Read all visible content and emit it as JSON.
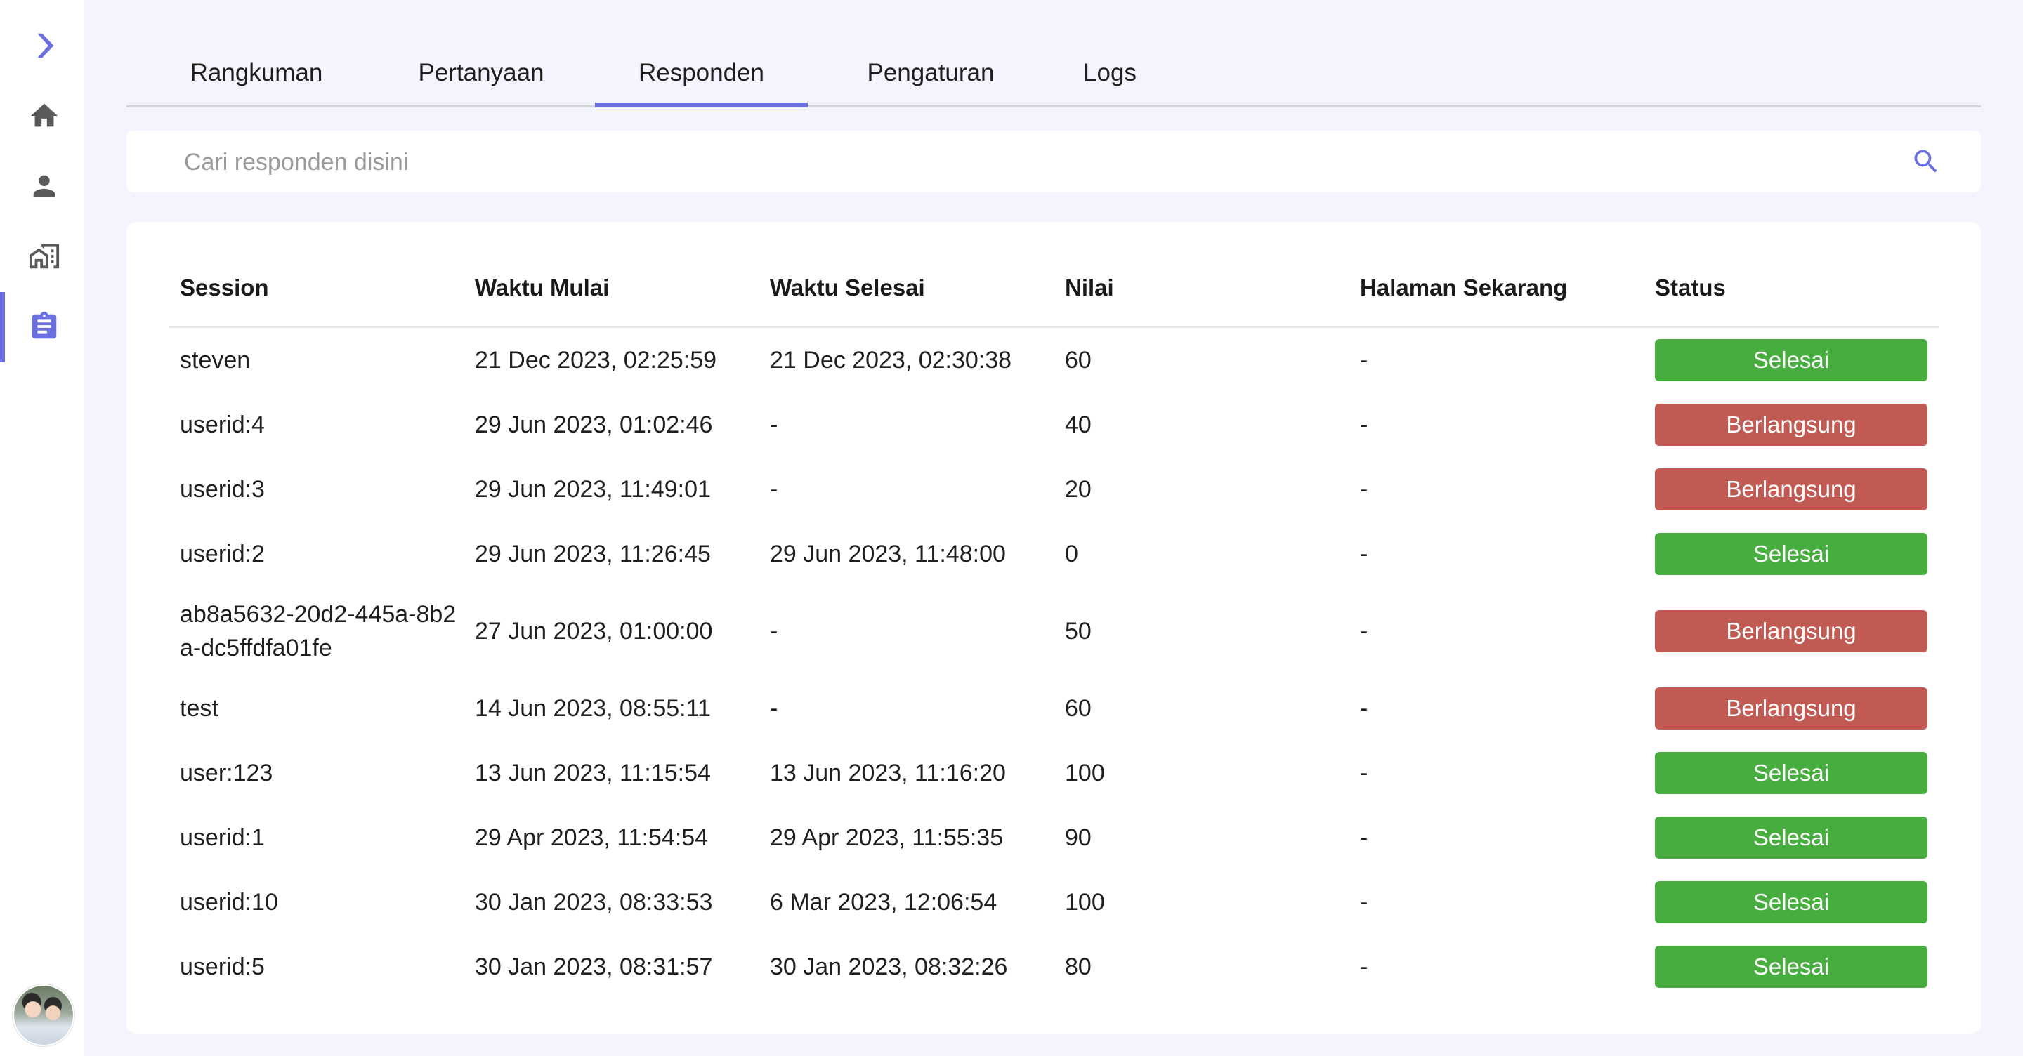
{
  "tabs": [
    {
      "label": "Rangkuman",
      "active": false
    },
    {
      "label": "Pertanyaan",
      "active": false
    },
    {
      "label": "Responden",
      "active": true
    },
    {
      "label": "Pengaturan",
      "active": false
    },
    {
      "label": "Logs",
      "active": false
    }
  ],
  "sidebar": {
    "icons": [
      "chevron-right-icon",
      "home-icon",
      "person-icon",
      "building-icon",
      "clipboard-icon"
    ],
    "active_item": "clipboard-icon",
    "accent_color": "#6b6fe0",
    "icon_color": "#5a5a5a"
  },
  "search": {
    "placeholder": "Cari responden disini",
    "value": ""
  },
  "table": {
    "headers": [
      "Session",
      "Waktu Mulai",
      "Waktu Selesai",
      "Nilai",
      "Halaman Sekarang",
      "Status"
    ],
    "rows": [
      {
        "session": "steven",
        "start": "21 Dec 2023, 02:25:59",
        "end": "21 Dec 2023, 02:30:38",
        "score": "60",
        "page": "-",
        "status": "Selesai"
      },
      {
        "session": "userid:4",
        "start": "29 Jun 2023, 01:02:46",
        "end": "-",
        "score": "40",
        "page": "-",
        "status": "Berlangsung"
      },
      {
        "session": "userid:3",
        "start": "29 Jun 2023, 11:49:01",
        "end": "-",
        "score": "20",
        "page": "-",
        "status": "Berlangsung"
      },
      {
        "session": "userid:2",
        "start": "29 Jun 2023, 11:26:45",
        "end": "29 Jun 2023, 11:48:00",
        "score": "0",
        "page": "-",
        "status": "Selesai"
      },
      {
        "session": "ab8a5632-20d2-445a-8b2a-dc5ffdfa01fe",
        "start": "27 Jun 2023, 01:00:00",
        "end": "-",
        "score": "50",
        "page": "-",
        "status": "Berlangsung"
      },
      {
        "session": "test",
        "start": "14 Jun 2023, 08:55:11",
        "end": "-",
        "score": "60",
        "page": "-",
        "status": "Berlangsung"
      },
      {
        "session": "user:123",
        "start": "13 Jun 2023, 11:15:54",
        "end": "13 Jun 2023, 11:16:20",
        "score": "100",
        "page": "-",
        "status": "Selesai"
      },
      {
        "session": "userid:1",
        "start": "29 Apr 2023, 11:54:54",
        "end": "29 Apr 2023, 11:55:35",
        "score": "90",
        "page": "-",
        "status": "Selesai"
      },
      {
        "session": "userid:10",
        "start": "30 Jan 2023, 08:33:53",
        "end": "6 Mar 2023, 12:06:54",
        "score": "100",
        "page": "-",
        "status": "Selesai"
      },
      {
        "session": "userid:5",
        "start": "30 Jan 2023, 08:31:57",
        "end": "30 Jan 2023, 08:32:26",
        "score": "80",
        "page": "-",
        "status": "Selesai"
      }
    ]
  },
  "colors": {
    "status_done": "#47ad3f",
    "status_in_progress": "#c05a52",
    "accent": "#6b6fe0",
    "background": "#f3f4fd"
  }
}
